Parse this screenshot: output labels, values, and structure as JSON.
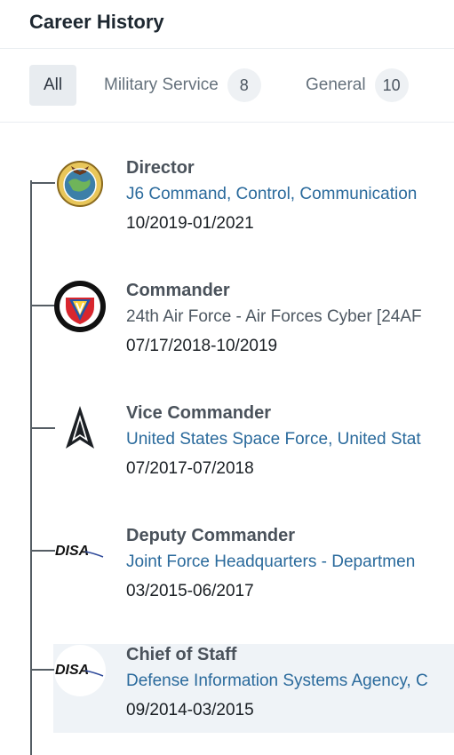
{
  "header": {
    "title": "Career History"
  },
  "tabs": [
    {
      "label": "All",
      "count": ""
    },
    {
      "label": "Military Service",
      "count": "8"
    },
    {
      "label": "General",
      "count": "10"
    }
  ],
  "positions": [
    {
      "role": "Director",
      "org": "J6 Command, Control, Communication",
      "dates": "10/2019-01/2021",
      "logo": "j6-seal-icon"
    },
    {
      "role": "Commander",
      "org": "24th Air Force - Air Forces Cyber [24AF",
      "dates": "07/17/2018-10/2019",
      "logo": "air-combat-command-icon"
    },
    {
      "role": "Vice Commander",
      "org": "United States Space Force,  United Stat",
      "dates": "07/2017-07/2018",
      "logo": "space-force-delta-icon"
    },
    {
      "role": "Deputy Commander",
      "org": "Joint Force Headquarters - Departmen",
      "dates": "03/2015-06/2017",
      "logo": "disa-logo-icon"
    },
    {
      "role": "Chief of Staff",
      "org": "Defense Information Systems Agency, C",
      "dates": "09/2014-03/2015",
      "logo": "disa-logo-icon"
    }
  ],
  "logo_text": {
    "disa": "DISA"
  },
  "colors": {
    "link": "#2a6a9c",
    "timeline": "#555d64",
    "highlight": "#eff3f7"
  }
}
